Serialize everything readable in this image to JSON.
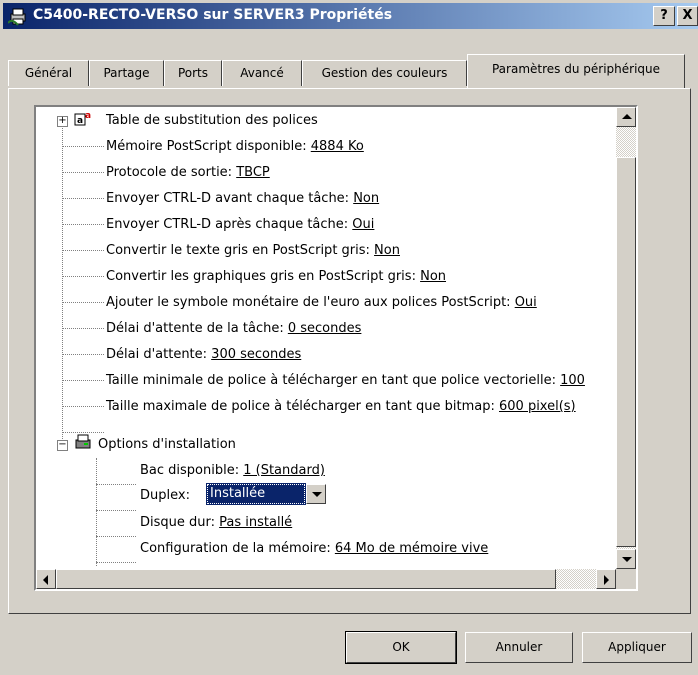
{
  "window": {
    "title": "C5400-RECTO-VERSO sur SERVER3 Propriétés",
    "help_glyph": "?",
    "close_glyph": "X"
  },
  "tabs": [
    {
      "label": "Général"
    },
    {
      "label": "Partage"
    },
    {
      "label": "Ports"
    },
    {
      "label": "Avancé"
    },
    {
      "label": "Gestion des couleurs"
    },
    {
      "label": "Paramètres du périphérique",
      "active": true
    }
  ],
  "tree": {
    "group1": {
      "label": "Table de substitution des polices",
      "expander": "+"
    },
    "items": [
      {
        "label": "Mémoire PostScript disponible: ",
        "value": "4884 Ko"
      },
      {
        "label": "Protocole de sortie: ",
        "value": "TBCP"
      },
      {
        "label": "Envoyer CTRL-D avant chaque tâche: ",
        "value": "Non"
      },
      {
        "label": "Envoyer CTRL-D après chaque tâche: ",
        "value": "Oui"
      },
      {
        "label": "Convertir le texte gris en PostScript gris: ",
        "value": "Non"
      },
      {
        "label": "Convertir les graphiques gris en PostScript gris: ",
        "value": "Non"
      },
      {
        "label": "Ajouter le symbole monétaire de l'euro aux polices PostScript: ",
        "value": "Oui"
      },
      {
        "label": "Délai d'attente de la tâche: ",
        "value": "0 secondes"
      },
      {
        "label": "Délai d'attente: ",
        "value": "300 secondes"
      },
      {
        "label": "Taille minimale de police à télécharger en tant que police vectorielle: ",
        "value": "100"
      },
      {
        "label": "Taille maximale de police à télécharger en tant que bitmap: ",
        "value": "600 pixel(s)"
      }
    ],
    "group2": {
      "label": "Options d'installation",
      "expander": "−",
      "bac": {
        "label": "Bac disponible: ",
        "value": "1 (Standard)"
      },
      "duplex": {
        "label": "Duplex:",
        "value": "Installée"
      },
      "disque": {
        "label": "Disque dur: ",
        "value": "Pas installé"
      },
      "memoire": {
        "label": "Configuration de la mémoire: ",
        "value": "64 Mo de mémoire vive"
      }
    }
  },
  "buttons": {
    "ok": "OK",
    "cancel": "Annuler",
    "apply": "Appliquer"
  }
}
